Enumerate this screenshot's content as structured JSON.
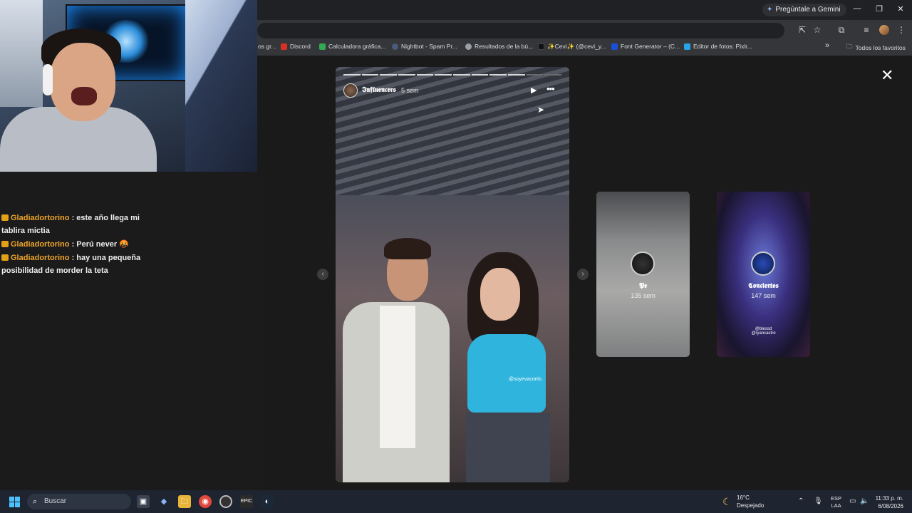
{
  "browser": {
    "gemini_label": "Pregúntale a Gemini",
    "window_controls": {
      "minimize": "—",
      "restore": "❐",
      "close": "✕"
    },
    "bookmarks": [
      {
        "label": "os gr...",
        "color": "#5f6368"
      },
      {
        "label": "Discord",
        "color": "#d93025"
      },
      {
        "label": "Calculadora gráfica...",
        "color": "#34a853"
      },
      {
        "label": "Nightbot - Spam Pr...",
        "color": "#4a5a7a"
      },
      {
        "label": "Resultados de la bú...",
        "color": "#9aa0a6"
      },
      {
        "label": "✨Cevi✨ (@cevi_y...",
        "color": "#111111"
      },
      {
        "label": "Font Generator – (C...",
        "color": "#1a4fd8"
      },
      {
        "label": "Editor de fotos: Pixlr...",
        "color": "#27a4e8"
      }
    ],
    "bookmarks_overflow": "»",
    "all_bookmarks": "Todos los favoritos"
  },
  "chat": {
    "messages": [
      {
        "user": "Gladiadortorino",
        "text": ": este año llega mi tablira mictia"
      },
      {
        "user": "Gladiadortorino",
        "text": ": Perú never 🤬"
      },
      {
        "user": "Gladiadortorino",
        "text": ": hay una pequeña posibilidad de morder la teta"
      }
    ]
  },
  "story": {
    "username": "𝕴𝖓𝖋𝖑𝖚𝖊𝖓𝖈𝖊𝖗𝖘",
    "time": "5 sem",
    "play_icon": "▶",
    "more_icon": "•••",
    "tag": "@soyevacortis",
    "close_icon": "✕",
    "prev_arrow": "‹",
    "next_arrow": "›",
    "progress_total": 12,
    "progress_done": 10
  },
  "previews": [
    {
      "name": "𝕻𝖊",
      "time": "135 sem",
      "handle": ""
    },
    {
      "name": "𝕮𝖔𝖓𝖈𝖎𝖊𝖗𝖙𝖔𝖘",
      "time": "147 sem",
      "handle": "@blessd\n@ryancastro"
    }
  ],
  "taskbar": {
    "search_placeholder": "Buscar",
    "temperature": "16°C",
    "condition": "Despejado",
    "lang_line1": "ESP",
    "lang_line2": "LAA",
    "time": "11:33 p. m.",
    "date": "6/08/2026"
  }
}
